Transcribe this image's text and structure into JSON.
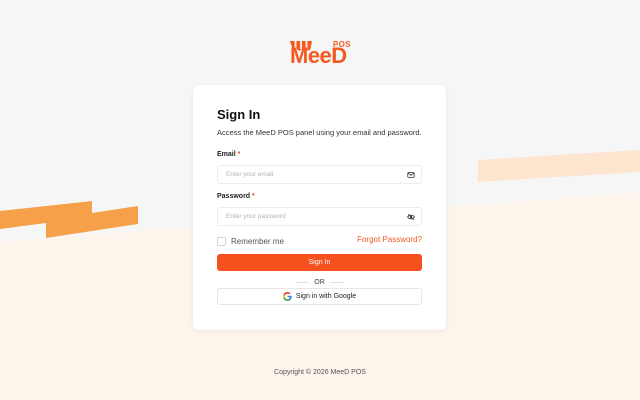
{
  "brand": {
    "logo_text": "MeeD",
    "logo_badge": "POS",
    "accent": "#f4511e",
    "navy": "#1a2a6c"
  },
  "card": {
    "title": "Sign In",
    "subtitle": "Access the MeeD POS panel using your email and password.",
    "email": {
      "label": "Email",
      "required_mark": "*",
      "placeholder": "Enter your email",
      "value": "",
      "icon": "mail-icon"
    },
    "password": {
      "label": "Password",
      "required_mark": "*",
      "placeholder": "Enter your password",
      "value": "",
      "icon": "eye-off-icon"
    },
    "remember_label": "Remember me",
    "remember_checked": false,
    "forgot_label": "Forgot Password?",
    "signin_label": "Sign In",
    "divider_label": "OR",
    "google_label": "Sign in with Google",
    "google_icon": "google-icon"
  },
  "footer": {
    "copyright": "Copyright © 2026 MeeD POS"
  }
}
